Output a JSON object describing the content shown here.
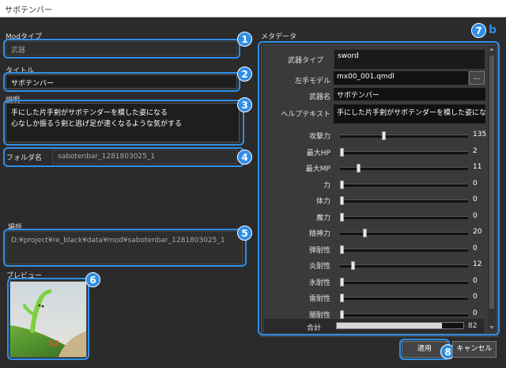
{
  "window": {
    "title": "サボテンバー"
  },
  "mod_type": {
    "label": "Modタイプ",
    "value": "武器"
  },
  "title_field": {
    "label": "タイトル",
    "value": "サボテンバー"
  },
  "description": {
    "label": "説明",
    "line1": "手にした片手剣がサボテンダーを模した姿になる",
    "line2": "心なしか振るう剣と逃げ足が速くなるような気がする"
  },
  "folder": {
    "label": "フォルダ名",
    "value": "sabotenbar_1281803025_1"
  },
  "location": {
    "label": "場所",
    "value": "D:¥project¥re_black¥data¥mod¥sabotenbar_1281803025_1"
  },
  "preview": {
    "label": "プレビュー",
    "overlay_text": "12"
  },
  "metadata": {
    "label": "メタデータ",
    "weapon_type": {
      "label": "武器タイプ",
      "value": "sword"
    },
    "left_model": {
      "label": "左手モデル",
      "value": "mx00_001.qmdl",
      "browse": "..."
    },
    "weapon_name": {
      "label": "武器名",
      "value": "サボテンバー"
    },
    "help_text": {
      "label": "ヘルプテキスト",
      "value": "手にした片手剣がサボテンダーを模した姿になる"
    },
    "stats": [
      {
        "label": "攻撃力",
        "value": 135,
        "fraction": 0.34
      },
      {
        "label": "最大HP",
        "value": 2,
        "fraction": 0.0
      },
      {
        "label": "最大MP",
        "value": 11,
        "fraction": 0.14
      },
      {
        "label": "力",
        "value": 0,
        "fraction": 0.0
      },
      {
        "label": "体力",
        "value": 0,
        "fraction": 0.0
      },
      {
        "label": "魔力",
        "value": 0,
        "fraction": 0.0
      },
      {
        "label": "精神力",
        "value": 20,
        "fraction": 0.19
      },
      {
        "label": "弾耐性",
        "value": 0,
        "fraction": 0.0
      },
      {
        "label": "炎耐性",
        "value": 12,
        "fraction": 0.1
      },
      {
        "label": "氷耐性",
        "value": 0,
        "fraction": 0.0
      },
      {
        "label": "雷耐性",
        "value": 0,
        "fraction": 0.0
      },
      {
        "label": "闇耐性",
        "value": 0,
        "fraction": 0.0
      }
    ],
    "total": {
      "label": "合計",
      "value": "82",
      "fraction": 0.83
    }
  },
  "buttons": {
    "apply": "適用",
    "cancel": "キャンセル"
  },
  "annotations": [
    "1",
    "2",
    "3",
    "4",
    "5",
    "6",
    "7",
    "8"
  ],
  "annotation_suffix": "b",
  "colors": {
    "accent": "#2f8fe8",
    "background": "#2b2b2b"
  }
}
